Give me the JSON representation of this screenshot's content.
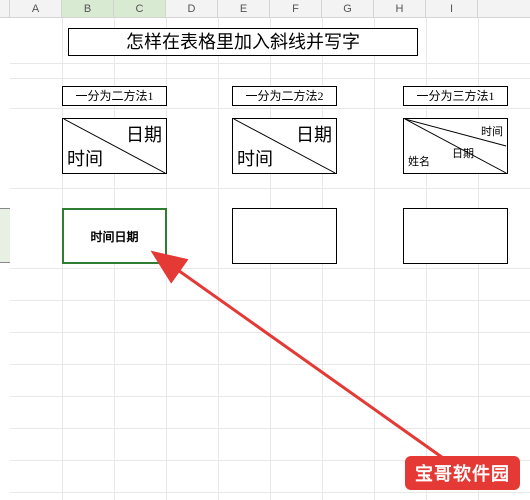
{
  "columns": [
    "A",
    "B",
    "C",
    "D",
    "E",
    "F",
    "G",
    "H",
    "I"
  ],
  "selected_columns": [
    "B",
    "C"
  ],
  "title": "怎样在表格里加入斜线并写字",
  "methods": [
    {
      "label": "一分为二方法1",
      "date": "日期",
      "time": "时间"
    },
    {
      "label": "一分为二方法2",
      "date": "日期",
      "time": "时间"
    },
    {
      "label": "一分为三方法1",
      "time": "时间",
      "date": "日期",
      "name": "姓名"
    }
  ],
  "editing_cell": "时间日期",
  "watermark": "宝哥软件园"
}
